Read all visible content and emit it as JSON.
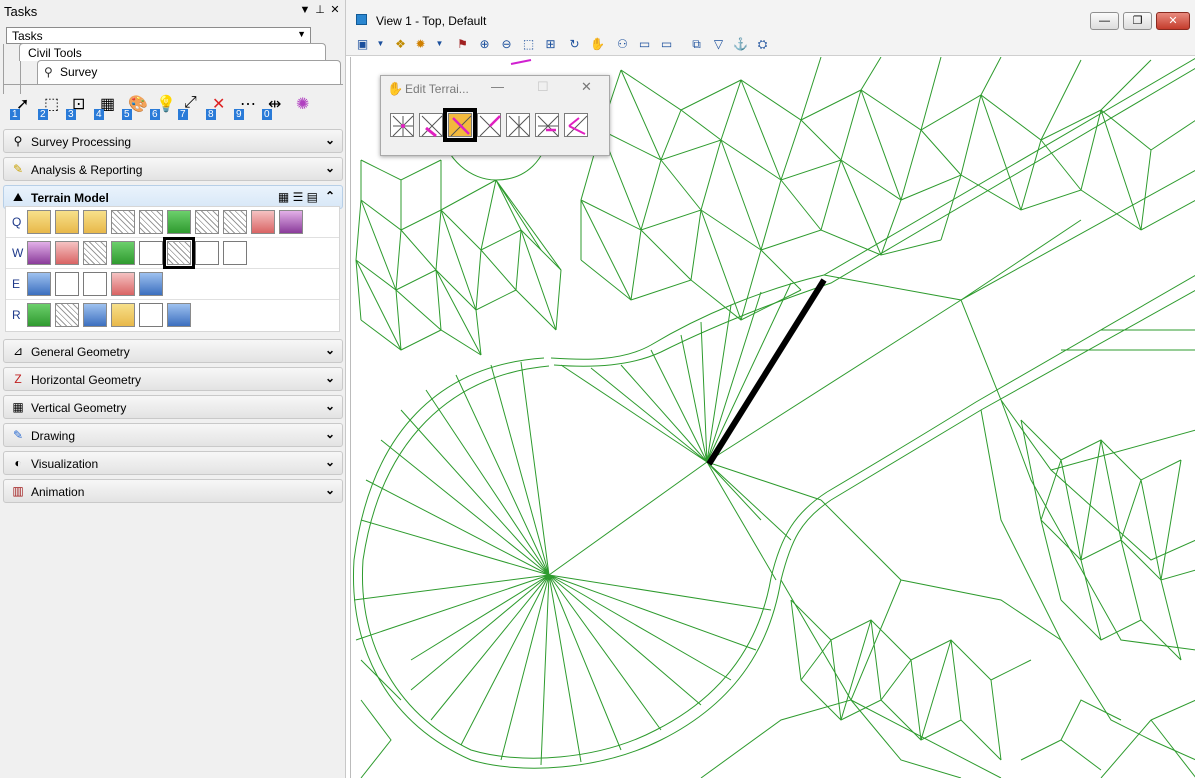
{
  "tasks_panel": {
    "title": "Tasks",
    "pin_glyph": "▼ 📌 ✕",
    "dropdown_value": "Tasks",
    "tree": [
      "Civil Tools",
      "Survey"
    ],
    "survey_numbers": [
      "1",
      "2",
      "3",
      "4",
      "5",
      "6",
      "7",
      "8",
      "9",
      "0"
    ],
    "sections_top": [
      "Survey Processing",
      "Analysis & Reporting"
    ],
    "terrain_section": "Terrain Model",
    "terrain_rows": [
      "Q",
      "W",
      "E",
      "R"
    ],
    "sections_bottom": [
      "General Geometry",
      "Horizontal Geometry",
      "Vertical Geometry",
      "Drawing",
      "Visualization",
      "Animation"
    ]
  },
  "view": {
    "title": "View 1 - Top, Default",
    "window_buttons": [
      "—",
      "❐",
      "✕"
    ]
  },
  "edit_dialog": {
    "title": "Edit Terrai...",
    "buttons": [
      "—",
      "☐",
      "✕"
    ]
  },
  "colors": {
    "tin_line": "#2e9b2e",
    "breakline": "#000000",
    "accent_selected": "#f3b93d"
  }
}
